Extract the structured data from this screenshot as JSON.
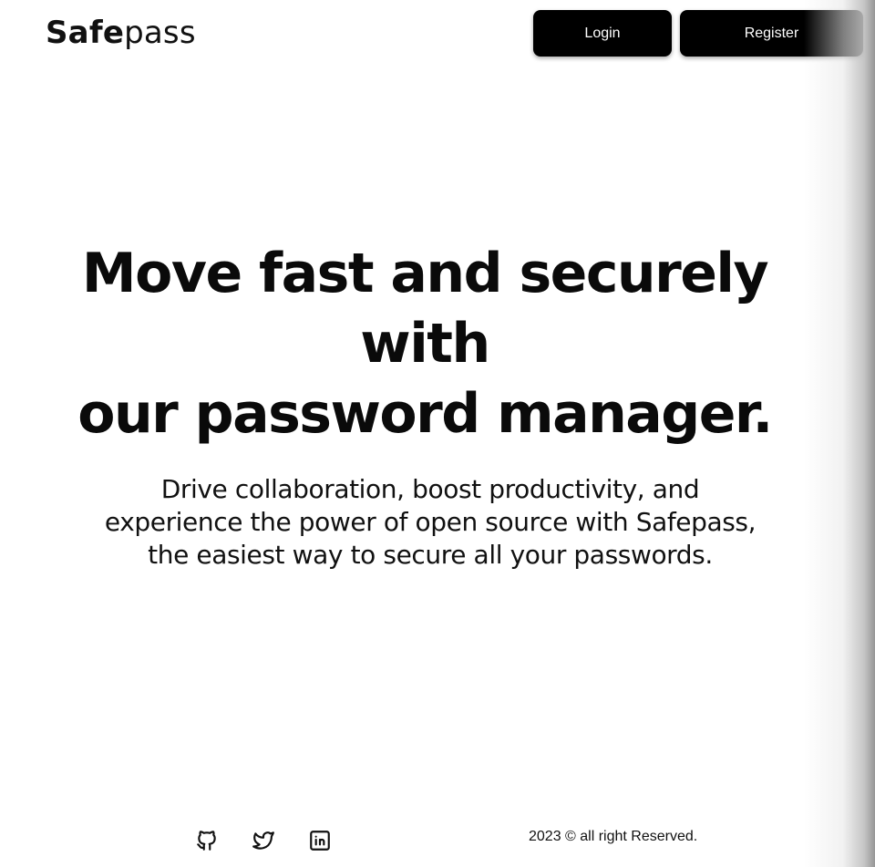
{
  "brand": {
    "name_bold": "Safe",
    "name_light": "pass"
  },
  "nav": {
    "login_label": "Login",
    "register_label": "Register"
  },
  "hero": {
    "title_line1": "Move fast and securely with",
    "title_line2": "our password manager.",
    "subtitle_line1": "Drive collaboration, boost productivity, and",
    "subtitle_line2": "experience the power of open source with Safepass,",
    "subtitle_line3": "the easiest way to secure all your passwords."
  },
  "footer": {
    "social_icons": [
      "github-icon",
      "twitter-icon",
      "linkedin-icon"
    ],
    "copyright": "2023 © all right Reserved."
  },
  "colors": {
    "background": "#ffffff",
    "button_bg": "#000000",
    "button_text": "#ffffff",
    "text": "#111111"
  }
}
